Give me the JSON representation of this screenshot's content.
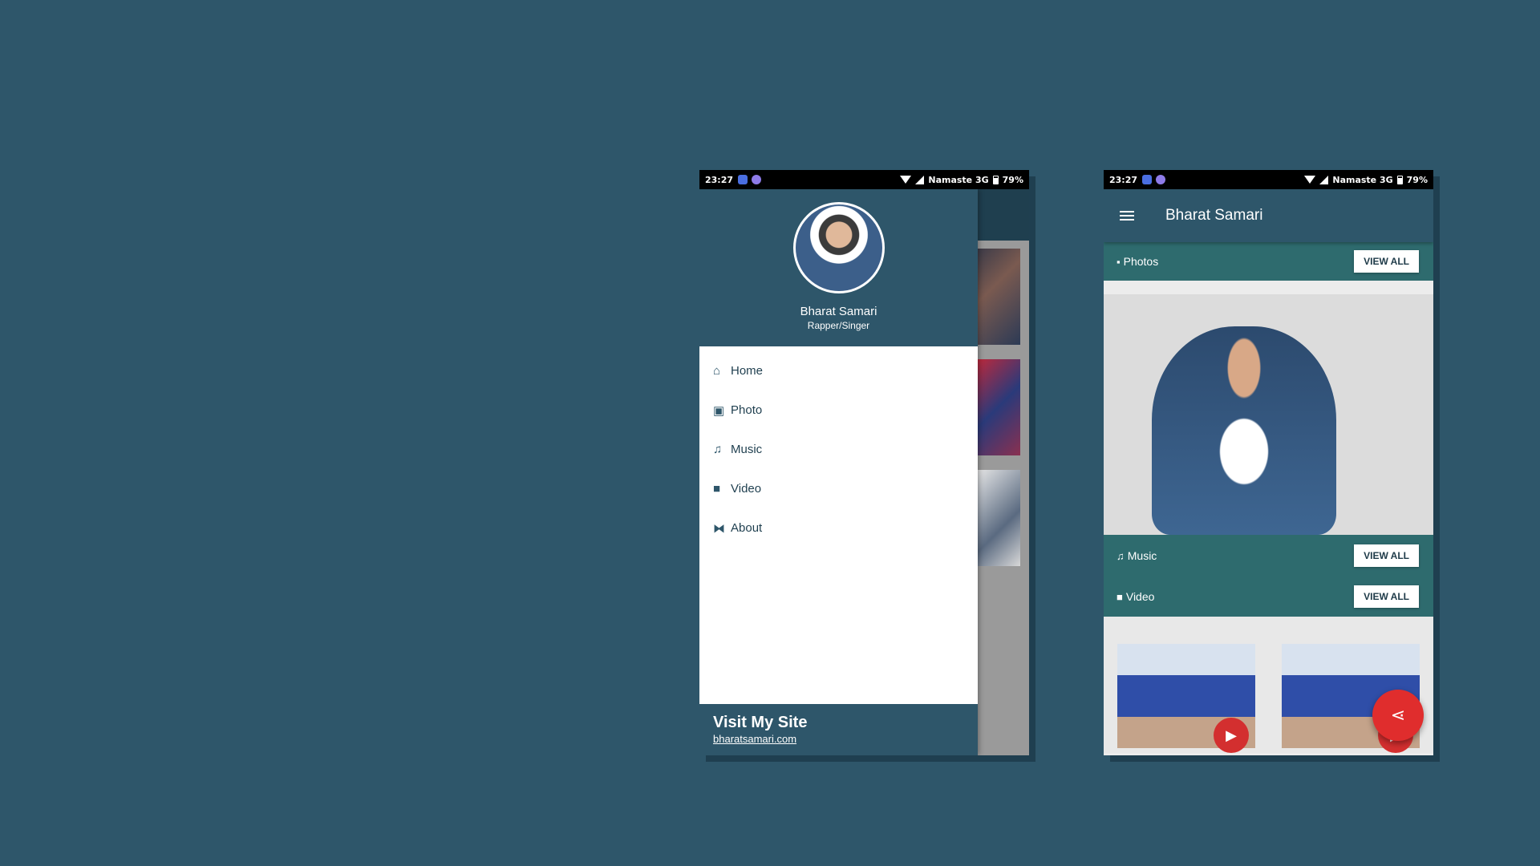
{
  "status_bar": {
    "time": "23:27",
    "carrier": "Namaste 3G",
    "battery": "79%"
  },
  "drawer": {
    "name": "Bharat Samari",
    "role": "Rapper/Singer",
    "items": [
      {
        "label": "Home",
        "icon": "home-icon",
        "glyph": "⌂"
      },
      {
        "label": "Photo",
        "icon": "photo-icon",
        "glyph": "▣"
      },
      {
        "label": "Music",
        "icon": "music-icon",
        "glyph": "♫"
      },
      {
        "label": "Video",
        "icon": "video-icon",
        "glyph": "■"
      },
      {
        "label": "About",
        "icon": "about-icon",
        "glyph": "⧓"
      }
    ],
    "footer": {
      "title": "Visit My Site",
      "link": "bharatsamari.com"
    }
  },
  "app": {
    "title": "Bharat Samari",
    "sections": {
      "photos": {
        "label": "Photos",
        "action": "VIEW ALL"
      },
      "music": {
        "label": "Music",
        "action": "VIEW ALL"
      },
      "video": {
        "label": "Video",
        "action": "VIEW ALL"
      }
    }
  },
  "colors": {
    "background": "#2e566a",
    "primary": "#2e566a",
    "section": "#2e6b6e",
    "fab": "#e02d2d"
  }
}
